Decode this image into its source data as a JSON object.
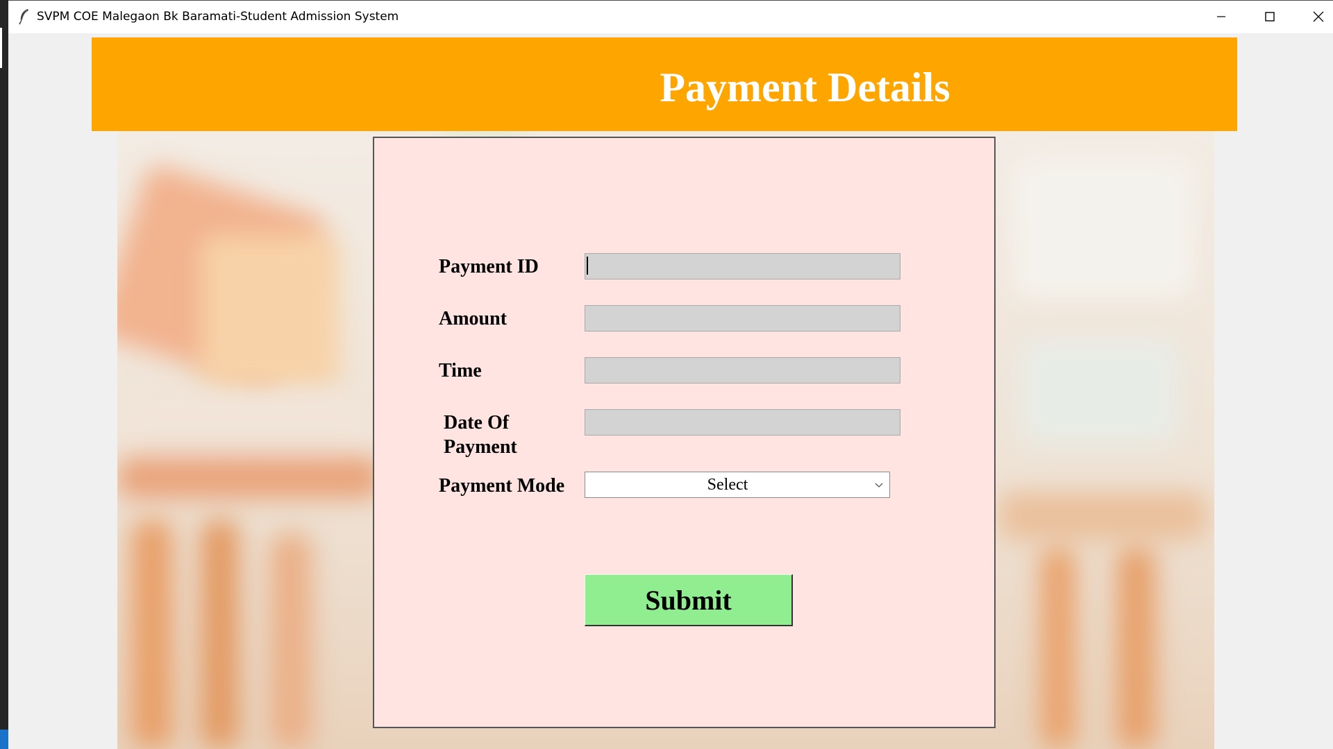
{
  "window": {
    "title": "SVPM COE Malegaon Bk Baramati-Student Admission System",
    "icon": "feather-icon",
    "controls": [
      "minimize-icon",
      "maximize-icon",
      "close-icon"
    ]
  },
  "header": {
    "title": "Payment Details",
    "background_color": "#ffa500",
    "text_color": "#ffffff"
  },
  "form": {
    "background_color": "#ffe4e1",
    "fields": {
      "payment_id": {
        "label": "Payment ID",
        "value": ""
      },
      "amount": {
        "label": "Amount",
        "value": ""
      },
      "time": {
        "label": "Time",
        "value": ""
      },
      "date_of_payment": {
        "label_line1": "Date Of",
        "label_line2": "Payment",
        "value": ""
      },
      "payment_mode": {
        "label": "Payment Mode",
        "selected": "Select"
      }
    },
    "entry_color": "#d3d3d3",
    "submit": {
      "label": "Submit",
      "color": "#90ee90"
    }
  }
}
